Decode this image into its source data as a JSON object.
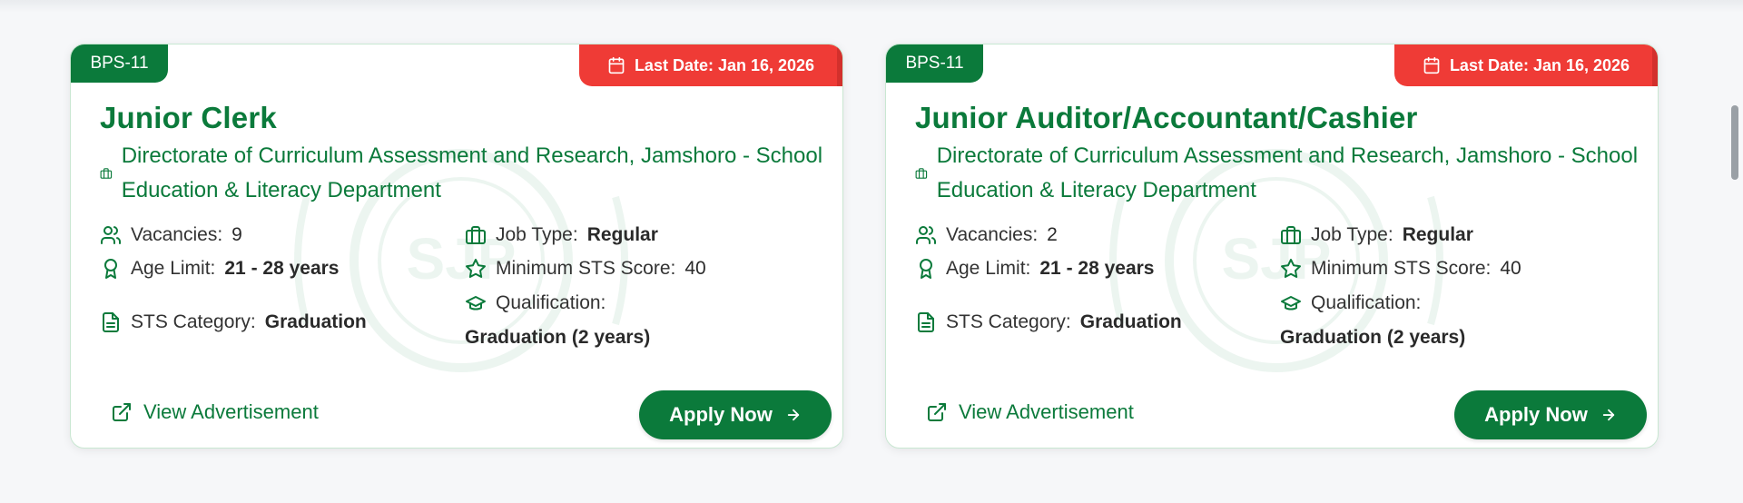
{
  "colors": {
    "brand_green": "#0b7a3b",
    "deadline_red": "#ef3b36",
    "background": "#f6f7f9"
  },
  "jobs": [
    {
      "grade": "BPS-11",
      "last_date": "Last Date: Jan 16, 2026",
      "title": "Junior Clerk",
      "department": "Directorate of Curriculum Assessment and Research, Jamshoro - School Education & Literacy Department",
      "vacancies_label": "Vacancies:",
      "vacancies": "9",
      "age_label": "Age Limit:",
      "age": "21 - 28 years",
      "sts_category_label": "STS Category:",
      "sts_category": "Graduation",
      "job_type_label": "Job Type:",
      "job_type": "Regular",
      "min_sts_label": "Minimum STS Score:",
      "min_sts": "40",
      "qualification_label": "Qualification:",
      "qualification": "Graduation (2 years)",
      "view_ad_label": "View Advertisement",
      "apply_label": "Apply Now"
    },
    {
      "grade": "BPS-11",
      "last_date": "Last Date: Jan 16, 2026",
      "title": "Junior Auditor/Accountant/Cashier",
      "department": "Directorate of Curriculum Assessment and Research, Jamshoro - School Education & Literacy Department",
      "vacancies_label": "Vacancies:",
      "vacancies": "2",
      "age_label": "Age Limit:",
      "age": "21 - 28 years",
      "sts_category_label": "STS Category:",
      "sts_category": "Graduation",
      "job_type_label": "Job Type:",
      "job_type": "Regular",
      "min_sts_label": "Minimum STS Score:",
      "min_sts": "40",
      "qualification_label": "Qualification:",
      "qualification": "Graduation (2 years)",
      "view_ad_label": "View Advertisement",
      "apply_label": "Apply Now"
    }
  ],
  "watermark": {
    "text": "SJP"
  },
  "icons": {
    "calendar": "calendar-icon",
    "department": "briefcase-icon",
    "vacancies": "users-icon",
    "age": "award-icon",
    "category": "document-icon",
    "job_type": "briefcase-icon",
    "sts": "star-icon",
    "qualification": "graduation-cap-icon",
    "external_link": "external-link-icon",
    "arrow": "arrow-right-icon"
  }
}
